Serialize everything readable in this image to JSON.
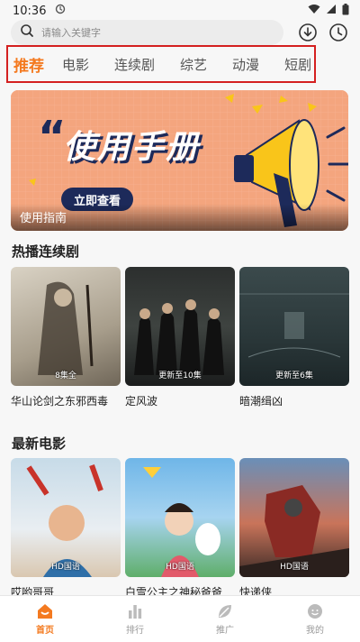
{
  "status_bar": {
    "time": "10:36"
  },
  "search": {
    "placeholder": "请输入关键字"
  },
  "tabs": [
    {
      "label": "推荐",
      "active": true
    },
    {
      "label": "电影"
    },
    {
      "label": "连续剧"
    },
    {
      "label": "综艺"
    },
    {
      "label": "动漫"
    },
    {
      "label": "短剧"
    }
  ],
  "banner": {
    "headline": "使用手册",
    "button_label": "立即查看",
    "caption": "使用指南"
  },
  "sections": {
    "series": {
      "title": "热播连续剧",
      "items": [
        {
          "title": "华山论剑之东邪西毒",
          "badge": "8集全"
        },
        {
          "title": "定风波",
          "badge": "更新至10集"
        },
        {
          "title": "暗潮缉凶",
          "badge": "更新至6集"
        }
      ]
    },
    "movies": {
      "title": "最新电影",
      "items": [
        {
          "title": "哎哟哥哥",
          "badge": "HD国语"
        },
        {
          "title": "白雪公主之神秘爸爸",
          "badge": "HD国语"
        },
        {
          "title": "快递侠",
          "badge": "HD国语"
        }
      ]
    }
  },
  "bottom_nav": [
    {
      "label": "首页",
      "icon": "home-icon",
      "active": true
    },
    {
      "label": "排行",
      "icon": "bar-chart-icon"
    },
    {
      "label": "推广",
      "icon": "leaf-icon"
    },
    {
      "label": "我的",
      "icon": "profile-icon"
    }
  ],
  "colors": {
    "accent": "#f47a20",
    "highlight_border": "#d42020"
  }
}
